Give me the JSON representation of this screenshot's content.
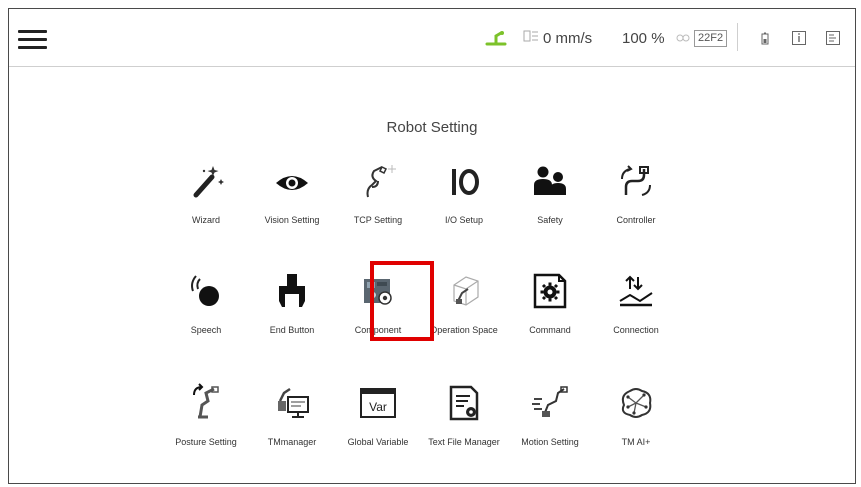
{
  "status_bar": {
    "speed": "0 mm/s",
    "percent": "100 %",
    "project_badge": "22F2"
  },
  "page": {
    "title": "Robot Setting"
  },
  "items": [
    {
      "label": "Wizard",
      "icon": "wizard-wand-icon"
    },
    {
      "label": "Vision Setting",
      "icon": "eye-icon"
    },
    {
      "label": "TCP Setting",
      "icon": "tcp-robot-arm-icon"
    },
    {
      "label": "I/O Setup",
      "icon": "io-icon"
    },
    {
      "label": "Safety",
      "icon": "safety-people-icon"
    },
    {
      "label": "Controller",
      "icon": "controller-arm-icon"
    },
    {
      "label": "Speech",
      "icon": "speech-icon"
    },
    {
      "label": "End Button",
      "icon": "gripper-icon"
    },
    {
      "label": "Component",
      "icon": "component-icon"
    },
    {
      "label": "Operation Space",
      "icon": "operation-space-icon"
    },
    {
      "label": "Command",
      "icon": "command-gear-icon"
    },
    {
      "label": "Connection",
      "icon": "connection-icon"
    },
    {
      "label": "Posture Setting",
      "icon": "posture-icon"
    },
    {
      "label": "TMmanager",
      "icon": "tmmanager-icon"
    },
    {
      "label": "Global Variable",
      "icon": "var-icon"
    },
    {
      "label": "Text File Manager",
      "icon": "text-file-icon"
    },
    {
      "label": "Motion Setting",
      "icon": "motion-icon"
    },
    {
      "label": "TM AI+",
      "icon": "ai-brain-icon"
    }
  ],
  "highlighted_item": "Component",
  "colors": {
    "highlight": "#e00000",
    "robot_status": "#7cc22a"
  }
}
